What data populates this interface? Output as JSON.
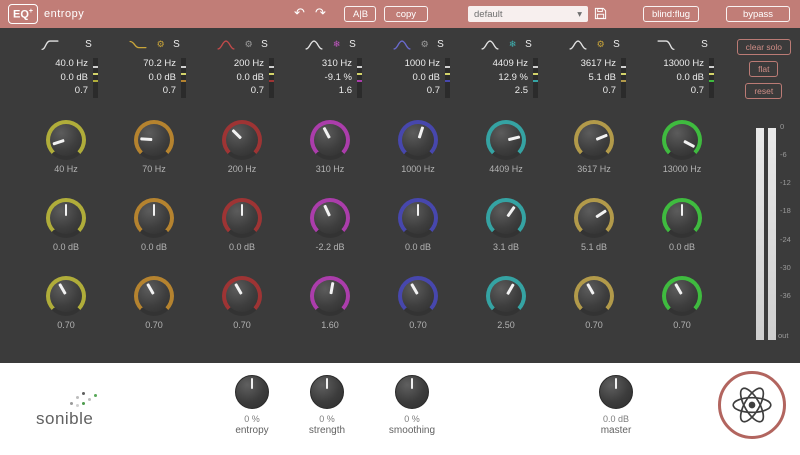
{
  "header": {
    "logo_text": "EQ",
    "logo_plus": "+",
    "product_name": "entropy",
    "undo_icon": "↶",
    "redo_icon": "↷",
    "ab_label": "A|B",
    "copy_label": "copy",
    "preset_value": "default",
    "caret_icon": "▾",
    "blindflug_label": "blind:flug",
    "bypass_label": "bypass"
  },
  "side_panel": {
    "clear_solo_label": "clear solo",
    "flat_label": "flat",
    "reset_label": "reset",
    "meter_scale": [
      "0",
      "-6",
      "-12",
      "-18",
      "-24",
      "-30",
      "-36"
    ],
    "meter_out_label": "out"
  },
  "bands": [
    {
      "solo_label": "S",
      "freq_display": "40.0 Hz",
      "gain_display": "0.0 dB",
      "q_display": "0.7",
      "freq_knob_label": "40 Hz",
      "gain_knob_label": "0.0 dB",
      "q_knob_label": "0.70",
      "color": "#b0ad3a",
      "curve_type": "lowcut",
      "curve_color": "#e2e2e2",
      "mode_icon": null,
      "knob_angles": {
        "freq": -108,
        "gain": 0,
        "q": -30
      }
    },
    {
      "solo_label": "S",
      "freq_display": "70.2 Hz",
      "gain_display": "0.0 dB",
      "q_display": "0.7",
      "freq_knob_label": "70 Hz",
      "gain_knob_label": "0.0 dB",
      "q_knob_label": "0.70",
      "color": "#b5832f",
      "curve_type": "lowshelf",
      "curve_color": "#c9a53a",
      "mode_icon": {
        "glyph": "⚙",
        "color": "#c9a53a"
      },
      "knob_angles": {
        "freq": -86,
        "gain": 0,
        "q": -30
      }
    },
    {
      "solo_label": "S",
      "freq_display": "200 Hz",
      "gain_display": "0.0 dB",
      "q_display": "0.7",
      "freq_knob_label": "200 Hz",
      "gain_knob_label": "0.0 dB",
      "q_knob_label": "0.70",
      "color": "#9e3434",
      "curve_type": "bell",
      "curve_color": "#c14a4a",
      "mode_icon": {
        "glyph": "⚙",
        "color": "#9c9c9c"
      },
      "knob_angles": {
        "freq": -45,
        "gain": 0,
        "q": -30
      }
    },
    {
      "solo_label": "S",
      "freq_display": "310 Hz",
      "gain_display": "-9.1 %",
      "q_display": "1.6",
      "freq_knob_label": "310 Hz",
      "gain_knob_label": "-2.2 dB",
      "q_knob_label": "1.60",
      "color": "#ab3dab",
      "curve_type": "bell",
      "curve_color": "#e2e2e2",
      "mode_icon": {
        "glyph": "❄",
        "color": "#c156c1"
      },
      "knob_angles": {
        "freq": -28,
        "gain": -25,
        "q": 10
      }
    },
    {
      "solo_label": "S",
      "freq_display": "1000 Hz",
      "gain_display": "0.0 dB",
      "q_display": "0.7",
      "freq_knob_label": "1000 Hz",
      "gain_knob_label": "0.0 dB",
      "q_knob_label": "0.70",
      "color": "#4747ad",
      "curve_type": "bell",
      "curve_color": "#6a6ace",
      "mode_icon": {
        "glyph": "⚙",
        "color": "#9c9c9c"
      },
      "knob_angles": {
        "freq": 18,
        "gain": 0,
        "q": -30
      }
    },
    {
      "solo_label": "S",
      "freq_display": "4409 Hz",
      "gain_display": "12.9 %",
      "q_display": "2.5",
      "freq_knob_label": "4409 Hz",
      "gain_knob_label": "3.1 dB",
      "q_knob_label": "2.50",
      "color": "#35a3a3",
      "curve_type": "bell",
      "curve_color": "#e2e2e2",
      "mode_icon": {
        "glyph": "❄",
        "color": "#3fb5b5"
      },
      "knob_angles": {
        "freq": 76,
        "gain": 35,
        "q": 30
      }
    },
    {
      "solo_label": "S",
      "freq_display": "3617 Hz",
      "gain_display": "5.1 dB",
      "q_display": "0.7",
      "freq_knob_label": "3617 Hz",
      "gain_knob_label": "5.1 dB",
      "q_knob_label": "0.70",
      "color": "#b29a4a",
      "curve_type": "bell",
      "curve_color": "#e2e2e2",
      "mode_icon": {
        "glyph": "⚙",
        "color": "#c9a53a"
      },
      "knob_angles": {
        "freq": 68,
        "gain": 57,
        "q": -30
      }
    },
    {
      "solo_label": "S",
      "freq_display": "13000 Hz",
      "gain_display": "0.0 dB",
      "q_display": "0.7",
      "freq_knob_label": "13000 Hz",
      "gain_knob_label": "0.0 dB",
      "q_knob_label": "0.70",
      "color": "#3fbb3f",
      "curve_type": "highcut",
      "curve_color": "#e2e2e2",
      "mode_icon": null,
      "knob_angles": {
        "freq": 118,
        "gain": 0,
        "q": -30
      }
    }
  ],
  "footer": {
    "brand": "sonible",
    "knobs": [
      {
        "value": "0 %",
        "label": "entropy"
      },
      {
        "value": "0 %",
        "label": "strength"
      },
      {
        "value": "0 %",
        "label": "smoothing"
      },
      {
        "value": "0.0 dB",
        "label": "master"
      }
    ]
  }
}
